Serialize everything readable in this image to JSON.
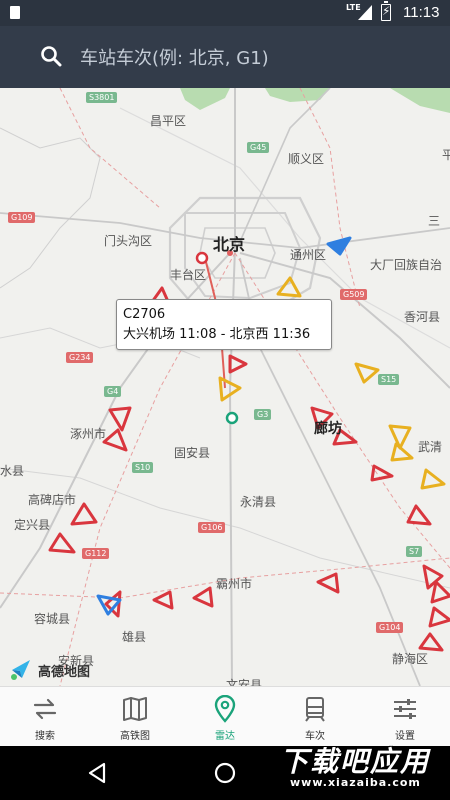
{
  "status_bar": {
    "network": "LTE",
    "time": "11:13"
  },
  "search": {
    "placeholder": "车站车次(例: 北京, G1)"
  },
  "map": {
    "labels": {
      "changping": "昌平区",
      "shunyi": "顺义区",
      "mentougou": "门头沟区",
      "beijing": "北京",
      "tongzhou": "通州区",
      "fengtai": "丰台区",
      "dachang": "大厂回族自治",
      "xianghe": "香河县",
      "zhuozhou": "涿州市",
      "langfang": "廊坊",
      "guan": "固安县",
      "gaobeidian": "高碑店市",
      "yongqing": "永清县",
      "wuqing": "武清",
      "dingxing": "定兴县",
      "bazhou": "霸州市",
      "rongcheng": "容城县",
      "anxin": "安新县",
      "xiongxian": "雄县",
      "jinghai": "静海区",
      "wenan": "文安县",
      "laishui": "水县",
      "ping": "平",
      "san": "三"
    },
    "road_shields": [
      "S3801",
      "G45",
      "G109",
      "G509",
      "G234",
      "G4",
      "G3",
      "S15",
      "S10",
      "G106",
      "G112",
      "S7",
      "G104"
    ]
  },
  "tooltip": {
    "train": "C2706",
    "route": "大兴机场 11:08 - 北京西 11:36"
  },
  "map_logo": {
    "text": "高德地图"
  },
  "nav": {
    "items": [
      {
        "label": "搜索",
        "icon": "search-swap-icon"
      },
      {
        "label": "高铁图",
        "icon": "map-book-icon"
      },
      {
        "label": "雷达",
        "icon": "location-pin-icon"
      },
      {
        "label": "车次",
        "icon": "train-icon"
      },
      {
        "label": "设置",
        "icon": "sliders-icon"
      }
    ],
    "active": "雷达",
    "active_color": "#1aa37a"
  },
  "watermark": {
    "main": "下载吧应用",
    "url": "www.xiazaiba.com"
  },
  "colors": {
    "header": "#333c4a",
    "marker_red": "#d9363e",
    "marker_yellow": "#e8b020",
    "marker_blue": "#2f7fe0"
  }
}
